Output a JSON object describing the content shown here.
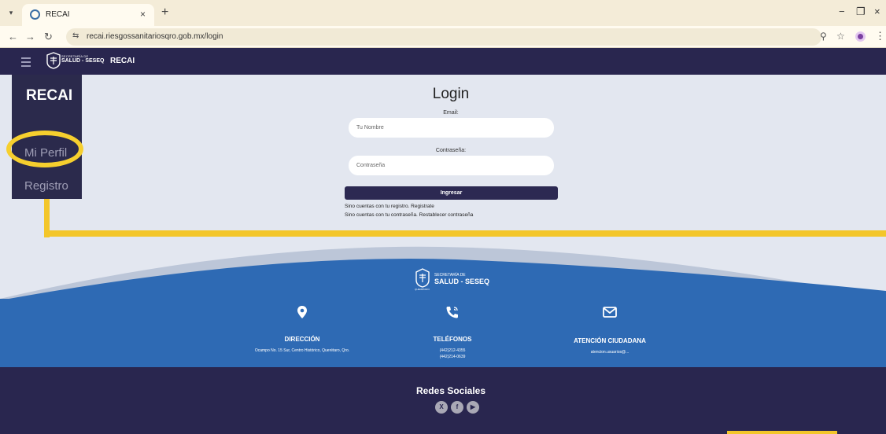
{
  "browser": {
    "tab_title": "RECAI",
    "tab_close": "×",
    "new_tab": "+",
    "url": "recai.riesgossanitariosqro.gob.mx/login",
    "icons": [
      "chevron-down-icon",
      "site-favicon",
      "back-icon",
      "forward-icon",
      "reload-icon",
      "site-info-icon",
      "zoom-icon",
      "star-icon",
      "profile-icon",
      "menu-icon",
      "minimize-icon",
      "restore-icon",
      "close-icon"
    ]
  },
  "header": {
    "logo_sub": "SECRETARÍA DE",
    "logo_main": "SALUD - SESEQ",
    "title": "RECAI"
  },
  "sidebar": {
    "title": "RECAI",
    "items": [
      {
        "label": "Mi Perfil"
      },
      {
        "label": "Registro"
      }
    ]
  },
  "login": {
    "title": "Login",
    "email_label": "Email:",
    "email_placeholder": "Tu Nombre",
    "password_label": "Contraseña:",
    "password_placeholder": "Contraseña",
    "submit_label": "Ingresar",
    "register_text": "Sino cuentas con tu registro. Registrate",
    "reset_text": "Sino cuentas con tu contraseña. Restablecer contraseña"
  },
  "footer": {
    "logo_sub": "SECRETARÍA DE",
    "logo_main": "SALUD - SESEQ",
    "logo_tiny": "QUERÉTARO",
    "direccion": {
      "title": "DIRECCIÓN",
      "text": "Ocampo No. 15 Sur, Centro Histórico, Querétaro, Qro."
    },
    "telefonos": {
      "title": "TELÉFONOS",
      "phone1": "(442)212-4355",
      "phone2": "(442)214-0639"
    },
    "atencion": {
      "title": "ATENCIÓN CIUDADANA",
      "text": "atencion.usuarios@..."
    },
    "redes_title": "Redes Sociales",
    "social": [
      "X",
      "f",
      "▶"
    ]
  },
  "colors": {
    "header": "#29264f",
    "footer_blue": "#2e6ab4",
    "highlight": "#f3c62a",
    "main_bg": "#e3e7f0"
  }
}
